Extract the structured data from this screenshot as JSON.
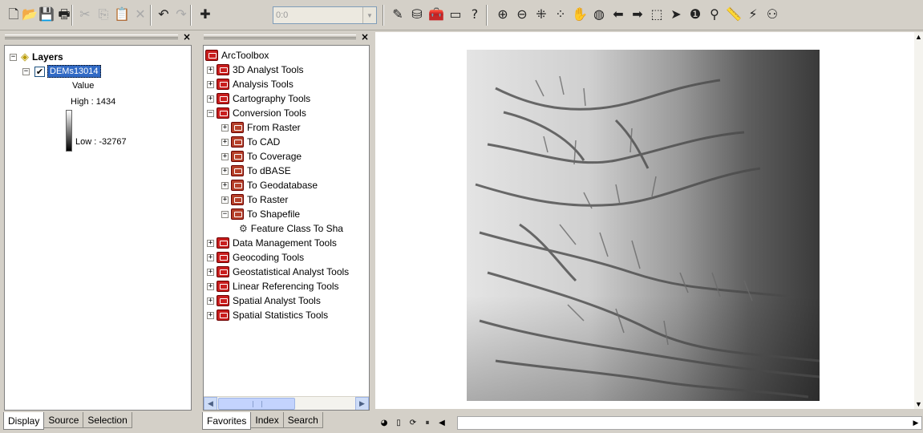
{
  "toolbar": {
    "buttons": [
      {
        "name": "new-document-icon",
        "glyph": "🗋",
        "enabled": true
      },
      {
        "name": "open-icon",
        "glyph": "📂",
        "enabled": true
      },
      {
        "name": "save-icon",
        "glyph": "💾",
        "enabled": true
      },
      {
        "name": "print-icon",
        "glyph": "🖶",
        "enabled": true
      },
      {
        "name": "cut-icon",
        "glyph": "✂",
        "enabled": false
      },
      {
        "name": "copy-icon",
        "glyph": "⎘",
        "enabled": false
      },
      {
        "name": "paste-icon",
        "glyph": "📋",
        "enabled": true
      },
      {
        "name": "delete-icon",
        "glyph": "✕",
        "enabled": false
      },
      {
        "name": "undo-icon",
        "glyph": "↶",
        "enabled": true
      },
      {
        "name": "redo-icon",
        "glyph": "↷",
        "enabled": false
      },
      {
        "name": "add-data-icon",
        "glyph": "✚",
        "enabled": true
      }
    ],
    "scale_value": "0:0",
    "buttons_right": [
      {
        "name": "editor-toolbar-icon",
        "glyph": "✎"
      },
      {
        "name": "arccatalog-icon",
        "glyph": "⛁"
      },
      {
        "name": "arctoolbox-icon",
        "glyph": "🧰"
      },
      {
        "name": "command-line-icon",
        "glyph": "▭"
      },
      {
        "name": "whats-this-icon",
        "glyph": "?"
      },
      {
        "name": "zoom-in-icon",
        "glyph": "⊕"
      },
      {
        "name": "zoom-out-icon",
        "glyph": "⊖"
      },
      {
        "name": "fixed-zoom-in-icon",
        "glyph": "⁜"
      },
      {
        "name": "fixed-zoom-out-icon",
        "glyph": "⁘"
      },
      {
        "name": "pan-icon",
        "glyph": "✋"
      },
      {
        "name": "full-extent-icon",
        "glyph": "◍"
      },
      {
        "name": "back-extent-icon",
        "glyph": "⬅"
      },
      {
        "name": "forward-extent-icon",
        "glyph": "➡"
      },
      {
        "name": "select-features-icon",
        "glyph": "⬚"
      },
      {
        "name": "select-elements-icon",
        "glyph": "➤"
      },
      {
        "name": "identify-icon",
        "glyph": "❶"
      },
      {
        "name": "find-icon",
        "glyph": "⚲"
      },
      {
        "name": "measure-icon",
        "glyph": "📏"
      },
      {
        "name": "hyperlink-icon",
        "glyph": "⚡"
      },
      {
        "name": "network-icon",
        "glyph": "⚇"
      }
    ]
  },
  "toc": {
    "root_label": "Layers",
    "layer_name": "DEMs13014",
    "legend_title": "Value",
    "high_label": "High : 1434",
    "low_label": "Low : -32767",
    "tabs": [
      "Display",
      "Source",
      "Selection"
    ]
  },
  "toolbox": {
    "root_label": "ArcToolbox",
    "items": [
      {
        "label": "3D Analyst Tools",
        "level": 1,
        "exp": "+",
        "type": "toolbox"
      },
      {
        "label": "Analysis Tools",
        "level": 1,
        "exp": "+",
        "type": "toolbox"
      },
      {
        "label": "Cartography Tools",
        "level": 1,
        "exp": "+",
        "type": "toolbox"
      },
      {
        "label": "Conversion Tools",
        "level": 1,
        "exp": "−",
        "type": "toolbox"
      },
      {
        "label": "From Raster",
        "level": 2,
        "exp": "+",
        "type": "toolset"
      },
      {
        "label": "To CAD",
        "level": 2,
        "exp": "+",
        "type": "toolset"
      },
      {
        "label": "To Coverage",
        "level": 2,
        "exp": "+",
        "type": "toolset"
      },
      {
        "label": "To dBASE",
        "level": 2,
        "exp": "+",
        "type": "toolset"
      },
      {
        "label": "To Geodatabase",
        "level": 2,
        "exp": "+",
        "type": "toolset"
      },
      {
        "label": "To Raster",
        "level": 2,
        "exp": "+",
        "type": "toolset"
      },
      {
        "label": "To Shapefile",
        "level": 2,
        "exp": "−",
        "type": "toolset"
      },
      {
        "label": "Feature Class To Sha",
        "level": 3,
        "exp": "",
        "type": "tool"
      },
      {
        "label": "Data Management Tools",
        "level": 1,
        "exp": "+",
        "type": "toolbox"
      },
      {
        "label": "Geocoding Tools",
        "level": 1,
        "exp": "+",
        "type": "toolbox"
      },
      {
        "label": "Geostatistical Analyst Tools",
        "level": 1,
        "exp": "+",
        "type": "toolbox"
      },
      {
        "label": "Linear Referencing Tools",
        "level": 1,
        "exp": "+",
        "type": "toolbox"
      },
      {
        "label": "Spatial Analyst Tools",
        "level": 1,
        "exp": "+",
        "type": "toolbox"
      },
      {
        "label": "Spatial Statistics Tools",
        "level": 1,
        "exp": "+",
        "type": "toolbox"
      }
    ],
    "tabs": [
      "Favorites",
      "Index",
      "Search"
    ]
  },
  "map": {
    "raster_description_colors": {
      "light": "#dcdcdc",
      "dark": "#3c3c3c"
    }
  }
}
